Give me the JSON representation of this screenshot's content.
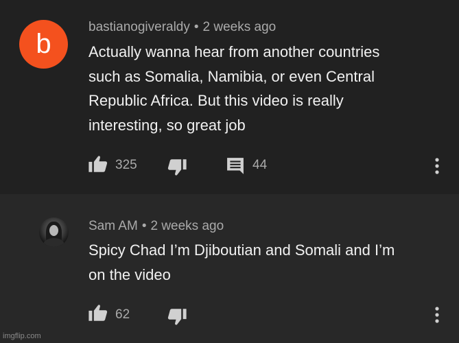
{
  "comments": [
    {
      "author": "bastianogiveraldy",
      "avatar_letter": "b",
      "avatar_color": "#f4511e",
      "separator": "•",
      "time": "2 weeks ago",
      "lines": [
        "Actually wanna hear from another countries",
        "such as Somalia, Namibia, or even Central",
        "Republic Africa. But this video is really",
        "interesting, so great job"
      ],
      "likes": "325",
      "replies": "44"
    },
    {
      "author": "Sam AM",
      "separator": "•",
      "time": "2 weeks ago",
      "lines": [
        "Spicy Chad I’m Djiboutian and Somali and I’m",
        "on the video"
      ],
      "likes": "62"
    }
  ],
  "icons": {
    "like": "thumb-up-icon",
    "dislike": "thumb-down-icon",
    "reply": "comment-icon",
    "menu": "more-vert-icon"
  },
  "watermark": "imgflip.com"
}
